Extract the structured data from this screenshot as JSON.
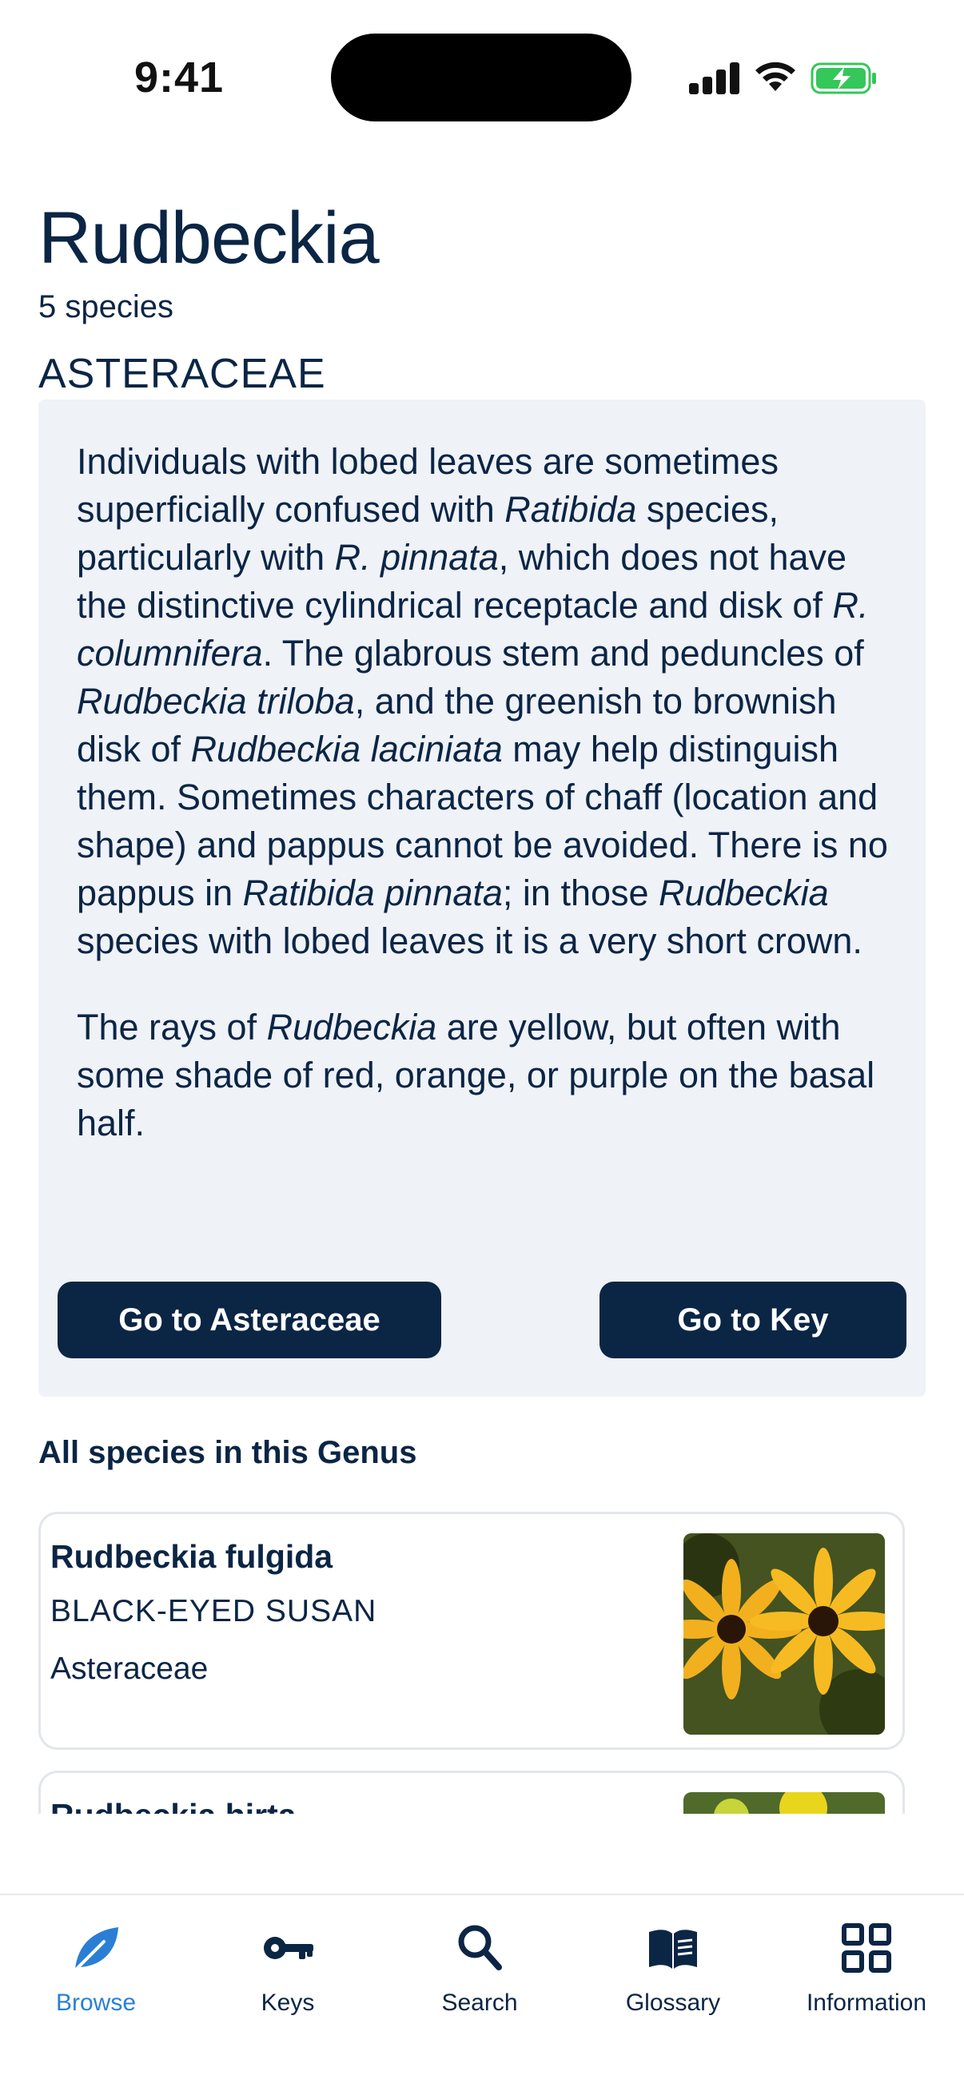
{
  "status": {
    "time": "9:41"
  },
  "header": {
    "title": "Rudbeckia",
    "subtitle": "5 species",
    "family": "ASTERACEAE"
  },
  "description": {
    "p1": [
      {
        "t": "Individuals with lobed leaves are sometimes superficially confused with ",
        "i": false
      },
      {
        "t": "Ratibida",
        "i": true
      },
      {
        "t": " species, particularly with ",
        "i": false
      },
      {
        "t": "R. pinnata",
        "i": true
      },
      {
        "t": ", which does not have the distinctive cylindrical receptacle and disk of ",
        "i": false
      },
      {
        "t": "R. columnifera",
        "i": true
      },
      {
        "t": ". The glabrous stem and peduncles of ",
        "i": false
      },
      {
        "t": "Rudbeckia triloba",
        "i": true
      },
      {
        "t": ", and the greenish to brownish disk of ",
        "i": false
      },
      {
        "t": "Rudbeckia laciniata",
        "i": true
      },
      {
        "t": " may help distinguish them. Sometimes characters of chaff (location and shape) and pappus cannot be avoided. There is no pappus in ",
        "i": false
      },
      {
        "t": "Ratibida pinnata",
        "i": true
      },
      {
        "t": "; in those ",
        "i": false
      },
      {
        "t": "Rudbeckia",
        "i": true
      },
      {
        "t": " species with lobed leaves it is a very short crown.",
        "i": false
      }
    ],
    "p2": [
      {
        "t": "The rays of ",
        "i": false
      },
      {
        "t": "Rudbeckia",
        "i": true
      },
      {
        "t": " are yellow, but often with some shade of red, orange, or purple on the basal half.",
        "i": false
      }
    ]
  },
  "buttons": {
    "go_family": "Go to Asteraceae",
    "go_key": "Go to Key"
  },
  "species_section": {
    "title": "All species in this Genus",
    "items": [
      {
        "name": "Rudbeckia fulgida",
        "common": "BLACK-EYED SUSAN",
        "family": "Asteraceae"
      },
      {
        "name": "Rudbeckia hirta",
        "common": "",
        "family": ""
      }
    ]
  },
  "tabs": [
    {
      "label": "Browse",
      "icon": "leaf-icon",
      "active": true
    },
    {
      "label": "Keys",
      "icon": "key-icon",
      "active": false
    },
    {
      "label": "Search",
      "icon": "search-icon",
      "active": false
    },
    {
      "label": "Glossary",
      "icon": "book-icon",
      "active": false
    },
    {
      "label": "Information",
      "icon": "grid-icon",
      "active": false
    }
  ],
  "colors": {
    "primary": "#0b2545",
    "accent": "#2a7fd4",
    "panel": "#eff2f7"
  }
}
